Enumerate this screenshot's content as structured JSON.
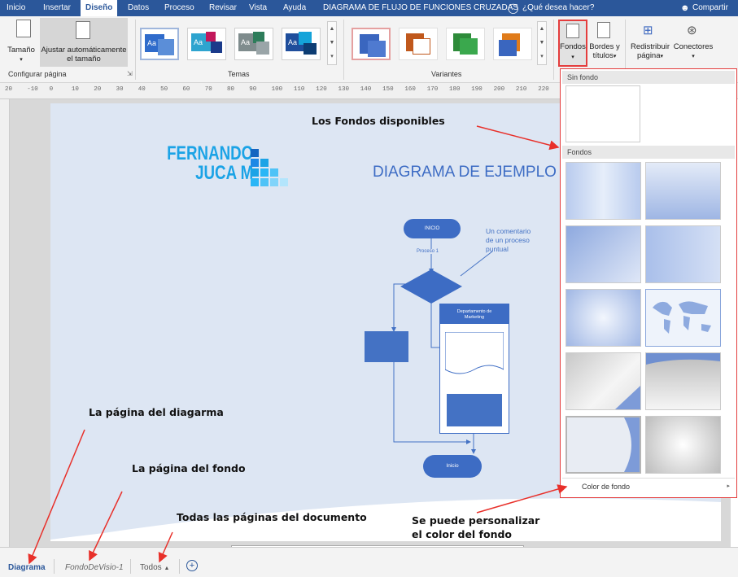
{
  "tabs": {
    "inicio": "Inicio",
    "insertar": "Insertar",
    "diseno": "Diseño",
    "datos": "Datos",
    "proceso": "Proceso",
    "revisar": "Revisar",
    "vista": "Vista",
    "ayuda": "Ayuda",
    "contextual": "DIAGRAMA DE FLUJO DE FUNCIONES CRUZADAS",
    "search": "¿Qué desea hacer?",
    "share": "Compartir"
  },
  "ribbon": {
    "tamano": "Tamaño",
    "ajustar_1": "Ajustar automáticamente",
    "ajustar_2": "el tamaño",
    "group_configurar": "Configurar página",
    "group_temas": "Temas",
    "group_variantes": "Variantes",
    "theme_label": "Aa",
    "fondos": "Fondos",
    "bordes_1": "Bordes y",
    "bordes_2": "títulos",
    "redistribuir_1": "Redistribuir",
    "redistribuir_2": "página",
    "conectores": "Conectores"
  },
  "ruler_ticks": [
    "20",
    "-10",
    "0",
    "10",
    "20",
    "30",
    "40",
    "50",
    "60",
    "70",
    "80",
    "90",
    "100",
    "110",
    "120",
    "130",
    "140",
    "150",
    "160",
    "170",
    "180",
    "190",
    "200",
    "210",
    "220"
  ],
  "diagram": {
    "logo_line1": "FERNANDO",
    "logo_line2": "JUCA M",
    "title": "DIAGRAMA DE EJEMPLO",
    "start": "INICIO",
    "comment_1": "Un comentario",
    "comment_2": "de un proceso",
    "comment_3": "puntual",
    "connector_label": "Proceso 1",
    "lane_header_1": "Departamento de",
    "lane_header_2": "Marketing",
    "end": "Inicio"
  },
  "panel": {
    "sin_fondo": "Sin fondo",
    "fondos": "Fondos",
    "color_de_fondo": "Color de fondo"
  },
  "annotations": {
    "fondos_disponibles": "Los Fondos disponibles",
    "pagina_diagrama": "La página del diagarma",
    "pagina_fondo": "La página del fondo",
    "todas_paginas": "Todas las páginas del documento",
    "personalizar_1": "Se puede personalizar",
    "personalizar_2": "el color del fondo"
  },
  "page_tabs": {
    "diagrama": "Diagrama",
    "fondo": "FondoDeVisio-1",
    "todos": "Todos",
    "add": "+"
  },
  "colors": {
    "ribbon_blue": "#2b579a",
    "shape_blue": "#4472c4",
    "annotation_red": "#e8302a",
    "comment_blue": "#4472c4"
  }
}
